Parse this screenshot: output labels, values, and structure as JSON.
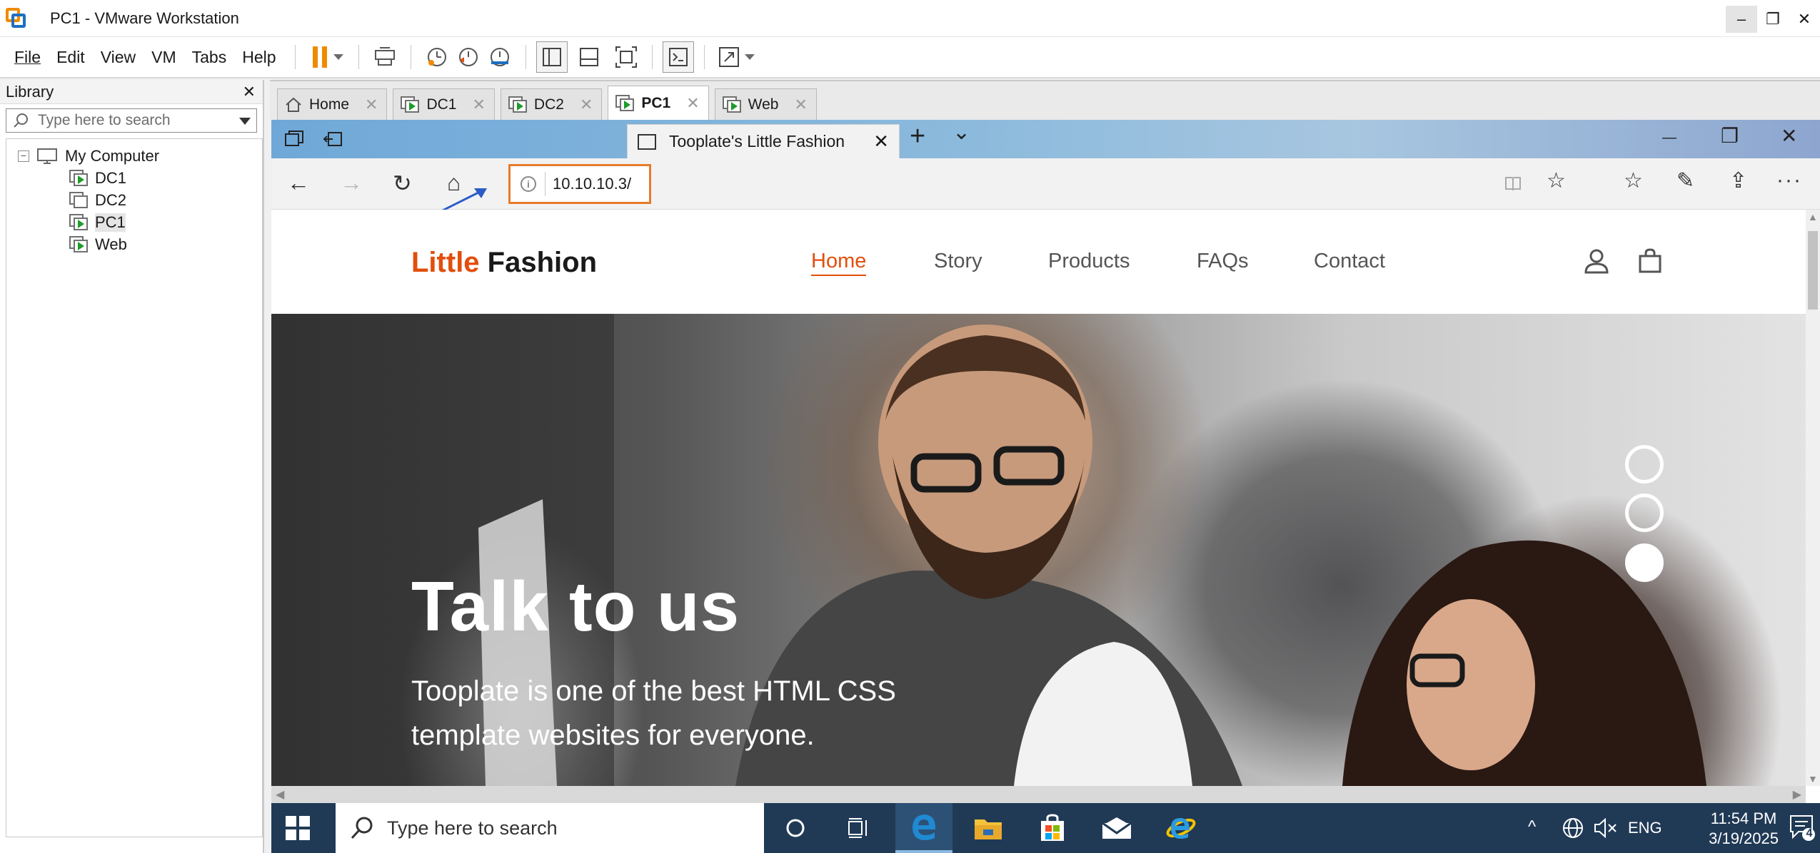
{
  "window": {
    "title": "PC1 - VMware Workstation",
    "controls": {
      "minimize": "–",
      "restore": "❐",
      "close": "✕"
    }
  },
  "menu": [
    "File",
    "Edit",
    "View",
    "VM",
    "Tabs",
    "Help"
  ],
  "library": {
    "title": "Library",
    "close": "✕",
    "search_placeholder": "Type here to search",
    "root": "My Computer",
    "root_expander": "−",
    "items": [
      {
        "label": "DC1",
        "running": true
      },
      {
        "label": "DC2",
        "running": false
      },
      {
        "label": "PC1",
        "running": true,
        "selected": true
      },
      {
        "label": "Web",
        "running": true
      }
    ]
  },
  "vm_tabs": [
    {
      "label": "Home",
      "icon": "home-icon",
      "active": false
    },
    {
      "label": "DC1",
      "icon": "vm-icon",
      "active": false
    },
    {
      "label": "DC2",
      "icon": "vm-icon",
      "active": false
    },
    {
      "label": "PC1",
      "icon": "vm-icon",
      "active": true
    },
    {
      "label": "Web",
      "icon": "vm-icon",
      "active": false
    }
  ],
  "tab_close": "✕",
  "browser": {
    "tab_title": "Tooplate's Little Fashion",
    "tab_close": "✕",
    "new_tab": "+",
    "tab_list": "⌄",
    "url": "10.10.10.3/",
    "info_glyph": "i",
    "glyphs": {
      "back": "←",
      "forward": "→",
      "refresh": "↻",
      "home": "⌂",
      "star": "☆",
      "favorites": "☆",
      "notes": "✎",
      "share": "⇪",
      "more": "···",
      "min": "—",
      "restore": "❐",
      "close": "✕"
    }
  },
  "site": {
    "brand_accent": "Little",
    "brand_rest": "Fashion",
    "nav": [
      "Home",
      "Story",
      "Products",
      "FAQs",
      "Contact"
    ],
    "active_nav": "Home",
    "hero_title": "Talk to us",
    "hero_sub": "Tooplate is one of the best HTML CSS template websites for everyone.",
    "carousel_active_index": 2
  },
  "taskbar": {
    "search_placeholder": "Type here to search",
    "apps": [
      "cortana-icon",
      "task-view-icon",
      "edge-icon",
      "file-explorer-icon",
      "store-icon",
      "mail-icon",
      "internet-explorer-icon"
    ],
    "tray": {
      "chevron": "^",
      "lang": "ENG"
    },
    "time": "11:54 PM",
    "date": "3/19/2025",
    "notifications": "4"
  },
  "colors": {
    "brand_orange": "#e24e0c",
    "url_highlight": "#e87b2a",
    "taskbar": "#203a56",
    "edge_titlebar": "#8cbadc",
    "vmware_pause": "#f08a00"
  }
}
